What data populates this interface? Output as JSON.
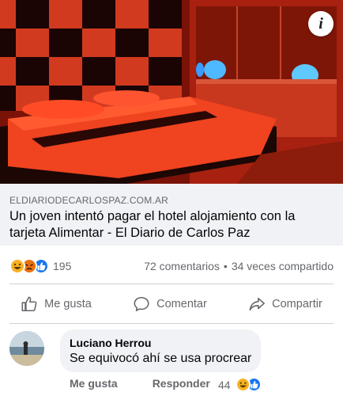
{
  "post": {
    "info_button_glyph": "i",
    "link_preview": {
      "domain": "ELDIARIODECARLOSPAZ.COM.AR",
      "headline": "Un joven intentó pagar el hotel alojamiento con la tarjeta Alimentar - El Diario de Carlos Paz"
    },
    "stats": {
      "reaction_icons": [
        "haha",
        "angry",
        "like"
      ],
      "reaction_count": "195",
      "comments": "72 comentarios",
      "separator": "•",
      "shares": "34 veces compartido"
    },
    "actions": {
      "like": "Me gusta",
      "comment": "Comentar",
      "share": "Compartir"
    }
  },
  "comment": {
    "author": "Luciano Herrou",
    "text": "Se equivocó ahí se usa procrear",
    "like_label": "Me gusta",
    "reply_label": "Responder",
    "reaction_count": "44",
    "reaction_icons": [
      "haha",
      "like"
    ]
  },
  "colors": {
    "accent_blue": "#1877f2",
    "muted_text": "#65676b",
    "bubble_bg": "#f0f2f5"
  }
}
